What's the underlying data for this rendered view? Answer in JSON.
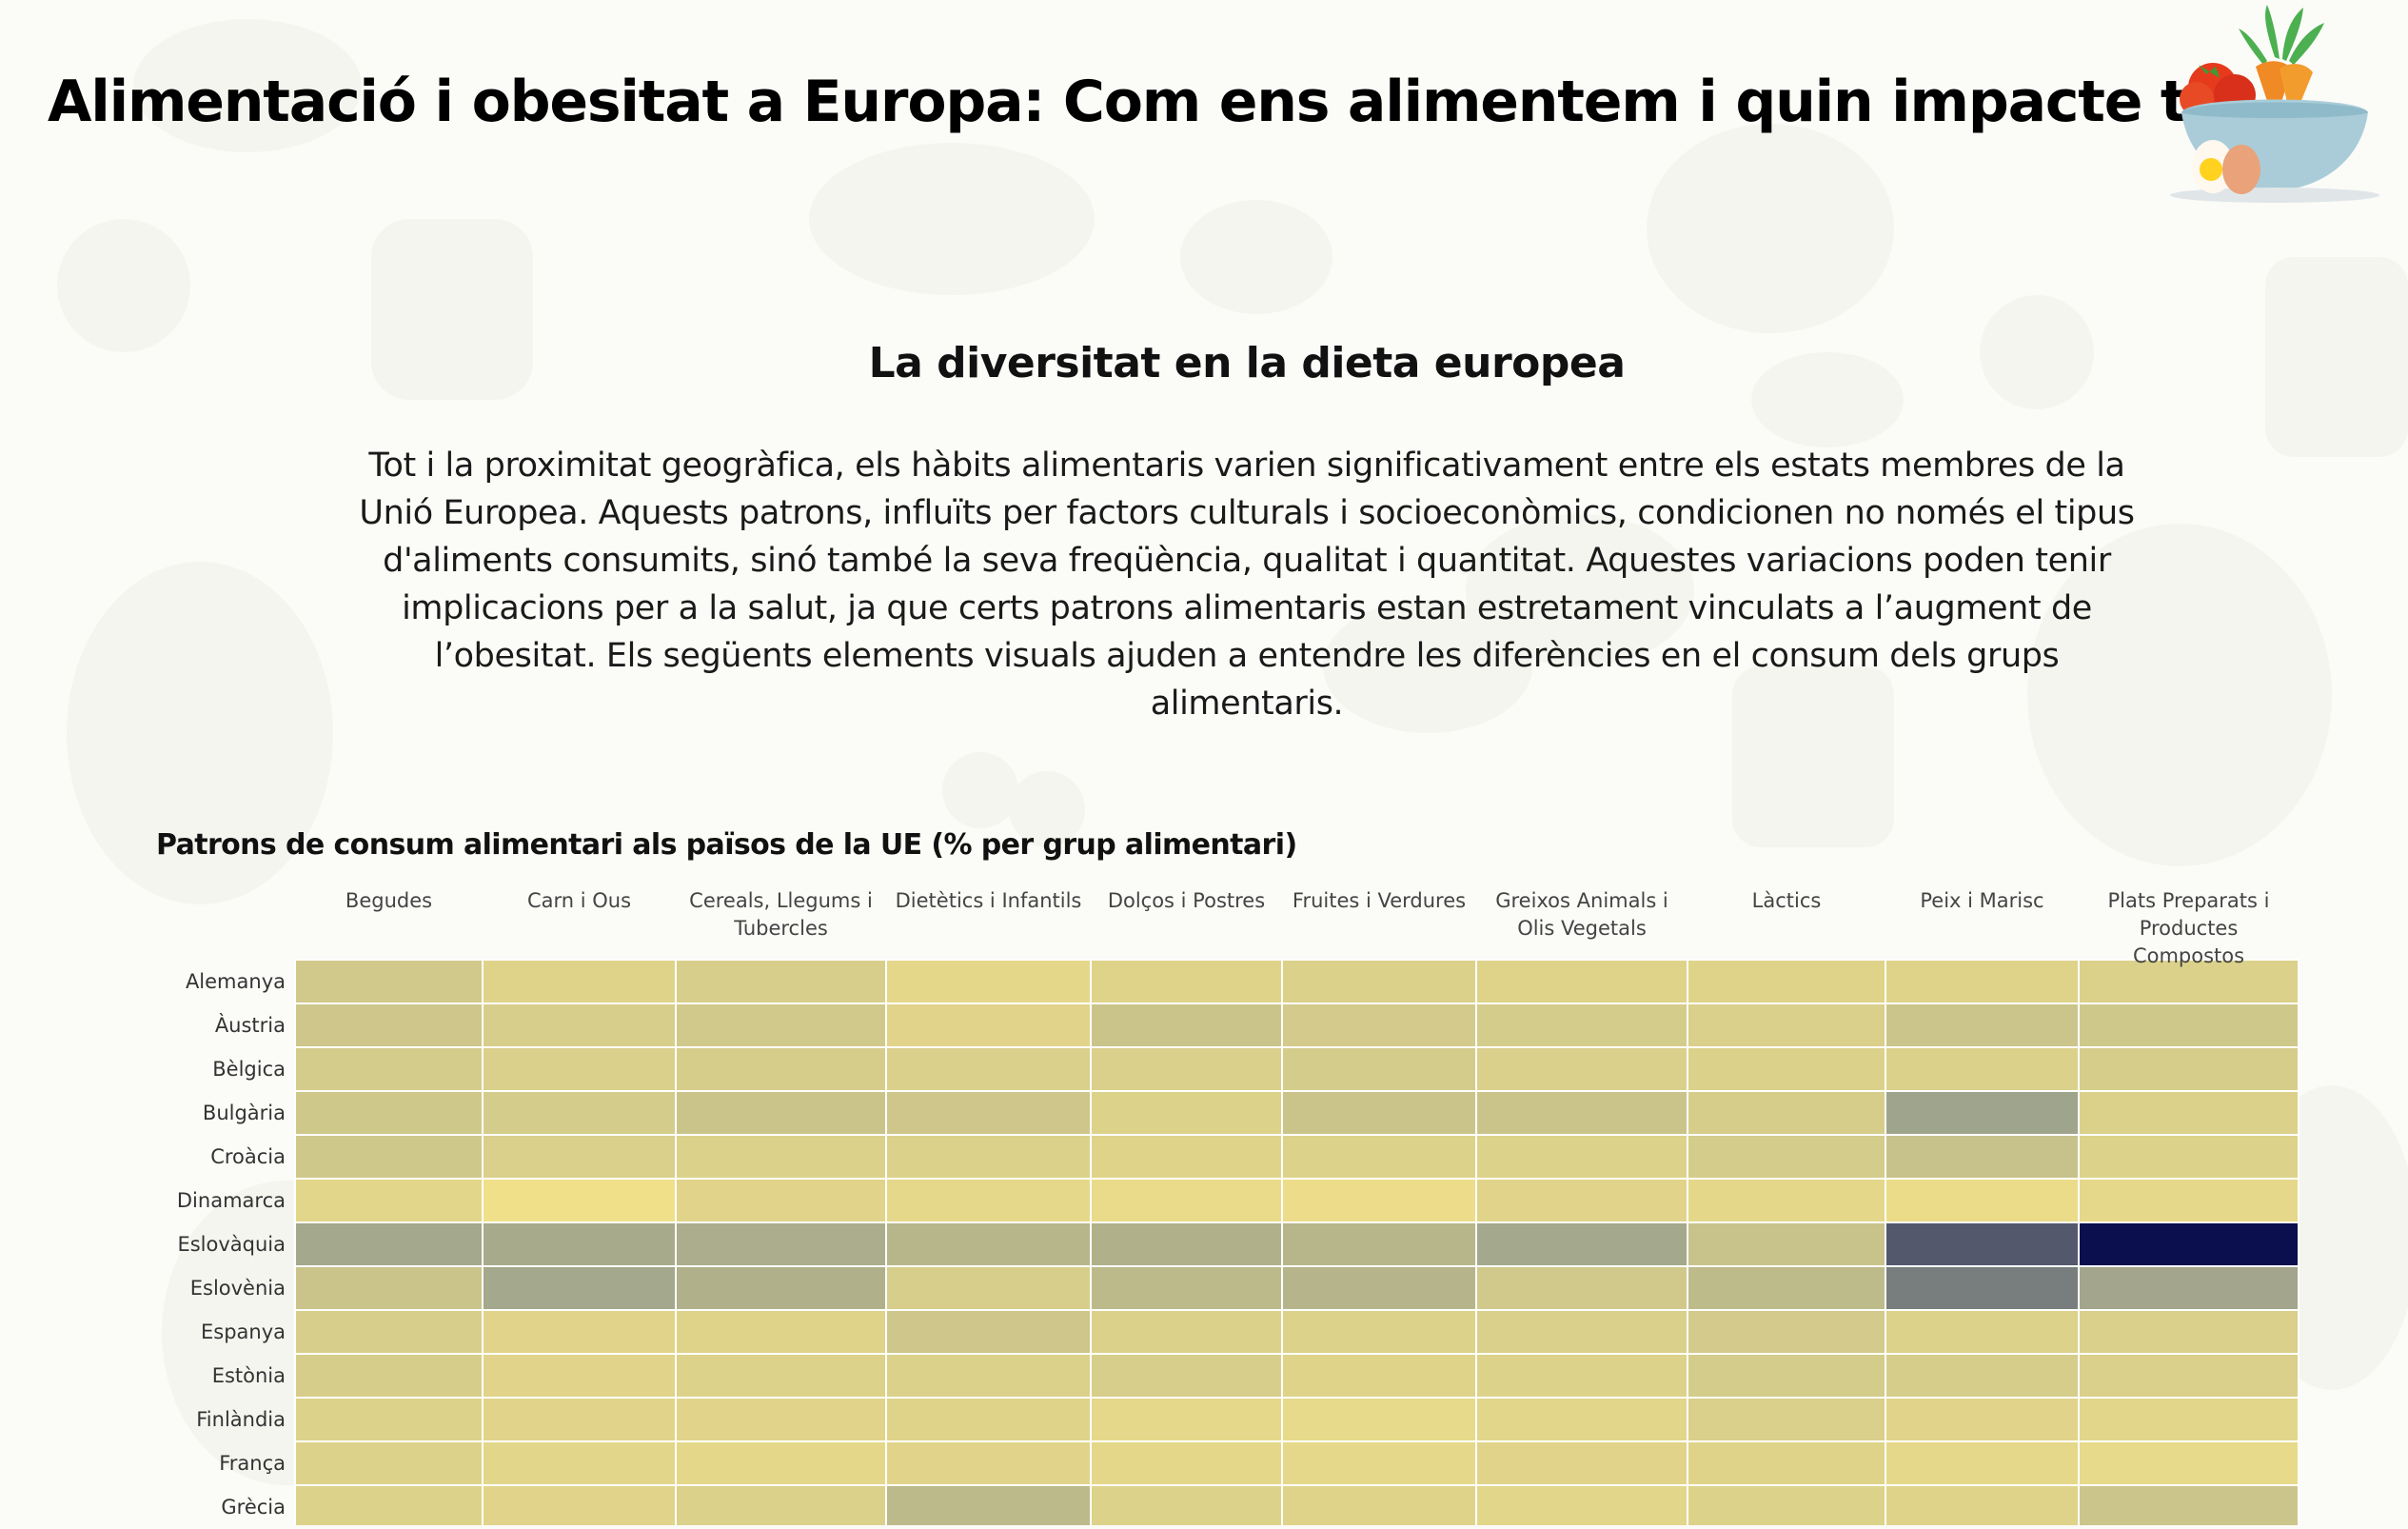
{
  "header": {
    "title": "Alimentació i obesitat a Europa: Com ens alimentem i quin impacte té?",
    "logo_icon": "vegetable-bowl-icon"
  },
  "section": {
    "title": "La diversitat en la dieta europea",
    "intro": "Tot i la proximitat geogràfica, els hàbits alimentaris varien significativament entre els estats membres de la Unió Europea. Aquests patrons, influïts per factors culturals i socioeconòmics, condicionen no només el tipus d'aliments consumits, sinó també la seva freqüència, qualitat i quantitat. Aquestes variacions poden tenir implicacions per a la salut, ja que certs patrons alimentaris estan estretament vinculats a l’augment de l’obesitat. Els següents elements visuals ajuden a entendre les diferències en el consum dels grups alimentaris."
  },
  "colors": {
    "scale_low": "#f0e08a",
    "scale_mid": "#9aa08c",
    "scale_high": "#0b0f4d"
  },
  "chart_data": {
    "type": "heatmap",
    "title": "Patrons de consum alimentari als països de la UE (% per grup alimentari)",
    "columns": [
      "Begudes",
      "Carn i Ous",
      "Cereals, Llegums i Tubercles",
      "Dietètics i Infantils",
      "Dolços i Postres",
      "Fruites i Verdures",
      "Greixos Animals i Olis Vegetals",
      "Làctics",
      "Peix i Marisc",
      "Plats Preparats i Productes Compostos"
    ],
    "rows": [
      "Alemanya",
      "Àustria",
      "Bèlgica",
      "Bulgària",
      "Croàcia",
      "Dinamarca",
      "Eslovàquia",
      "Eslovènia",
      "Espanya",
      "Estònia",
      "Finlàndia",
      "França",
      "Grècia"
    ],
    "values": [
      [
        0.18,
        0.1,
        0.14,
        0.07,
        0.1,
        0.12,
        0.1,
        0.1,
        0.1,
        0.12
      ],
      [
        0.2,
        0.14,
        0.18,
        0.09,
        0.22,
        0.17,
        0.16,
        0.13,
        0.21,
        0.19
      ],
      [
        0.16,
        0.13,
        0.15,
        0.13,
        0.13,
        0.16,
        0.13,
        0.12,
        0.12,
        0.15
      ],
      [
        0.19,
        0.16,
        0.22,
        0.2,
        0.11,
        0.22,
        0.22,
        0.15,
        0.47,
        0.12
      ],
      [
        0.19,
        0.13,
        0.12,
        0.12,
        0.1,
        0.11,
        0.11,
        0.16,
        0.24,
        0.11
      ],
      [
        0.08,
        0.0,
        0.09,
        0.06,
        0.04,
        0.02,
        0.09,
        0.07,
        0.03,
        0.06
      ],
      [
        0.44,
        0.42,
        0.4,
        0.33,
        0.37,
        0.33,
        0.44,
        0.23,
        0.75,
        1.0
      ],
      [
        0.22,
        0.44,
        0.37,
        0.14,
        0.3,
        0.34,
        0.18,
        0.29,
        0.62,
        0.45
      ],
      [
        0.14,
        0.09,
        0.1,
        0.2,
        0.12,
        0.11,
        0.13,
        0.17,
        0.11,
        0.13
      ],
      [
        0.15,
        0.09,
        0.11,
        0.12,
        0.14,
        0.1,
        0.11,
        0.16,
        0.15,
        0.13
      ],
      [
        0.11,
        0.09,
        0.09,
        0.1,
        0.06,
        0.05,
        0.08,
        0.13,
        0.09,
        0.08
      ],
      [
        0.11,
        0.08,
        0.07,
        0.09,
        0.07,
        0.06,
        0.09,
        0.1,
        0.06,
        0.05
      ],
      [
        0.11,
        0.09,
        0.12,
        0.3,
        0.11,
        0.1,
        0.08,
        0.11,
        0.1,
        0.21
      ]
    ]
  }
}
